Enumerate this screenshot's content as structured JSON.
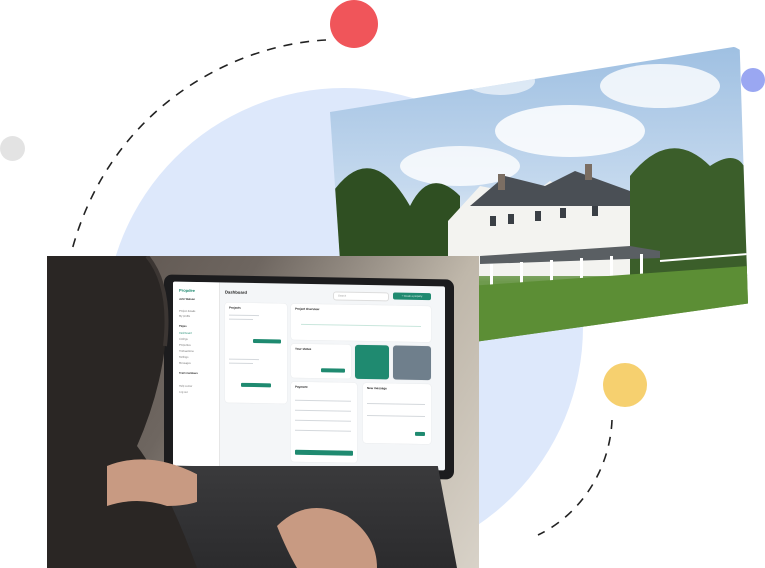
{
  "colors": {
    "blob": "#dde8fb",
    "dot_red": "#f0555a",
    "dot_purple": "#9aa7f2",
    "dot_gray": "#e3e3e3",
    "dot_yellow": "#f6d06f",
    "accent_green": "#1f8a70"
  },
  "dashboard": {
    "brand": "Propdee",
    "title": "Dashboard",
    "search_placeholder": "Search",
    "create_button": "+ Create a property",
    "sidebar_items": [
      "Jane Watson",
      "Project details",
      "My profile",
      "Pages",
      "Dashboard",
      "Listings",
      "Properties",
      "Transactions",
      "Settings",
      "Messages",
      "Team members",
      "Help center",
      "Log out"
    ],
    "panels": {
      "projects": "Projects",
      "project_overview": "Project Overview",
      "your_status": "Your status",
      "payment": "Payment",
      "new_message": "New message"
    }
  }
}
